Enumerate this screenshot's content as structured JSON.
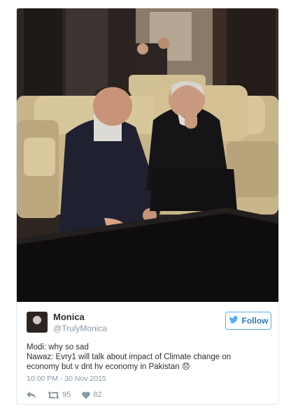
{
  "tweet": {
    "display_name": "Monica",
    "handle": "@TrulyMonica",
    "follow_label": "Follow",
    "text_line1": "Modi: why so sad",
    "text_line2": "Nawaz: Evry1 will talk about impact of Climate change on",
    "text_line3": "economy but v dnt hv economy in Pakistan 😞",
    "timestamp": "10:00 PM - 30 Nov 2015",
    "retweets": "95",
    "likes": "82"
  },
  "icons": {
    "reply": "reply-icon",
    "retweet": "retweet-icon",
    "like": "heart-icon",
    "follow": "twitter-bird-icon"
  },
  "colors": {
    "accent": "#55acee",
    "follow_text": "#2b7bb9",
    "muted": "#8899a6",
    "text": "#292f33"
  }
}
